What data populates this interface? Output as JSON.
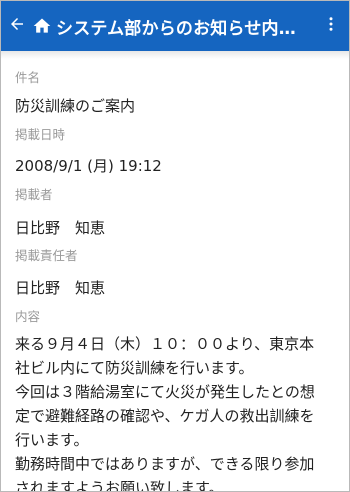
{
  "header": {
    "title": "システム部からのお知らせ内…",
    "back_icon": "arrow-left-icon",
    "home_icon": "home-icon",
    "menu_icon": "more-vertical-icon",
    "bar_color": "#1565c0"
  },
  "fields": {
    "subject_label": "件名",
    "subject_value": "防災訓練のご案内",
    "date_label": "掲載日時",
    "date_value": "2008/9/1 (月) 19:12",
    "poster_label": "掲載者",
    "poster_value": "日比野　知恵",
    "responsible_label": "掲載責任者",
    "responsible_value": "日比野　知恵",
    "content_label": "内容",
    "content_lines": [
      "来る９月４日（木）１０：００より、東京本",
      "社ビル内にて防災訓練を行います。",
      "今回は３階給湯室にて火災が発生したとの想",
      "定で避難経路の確認や、ケガ人の救出訓練を",
      "行います。",
      "勤務時間中ではありますが、できる限り参加",
      "されますようお願い致します。"
    ]
  }
}
